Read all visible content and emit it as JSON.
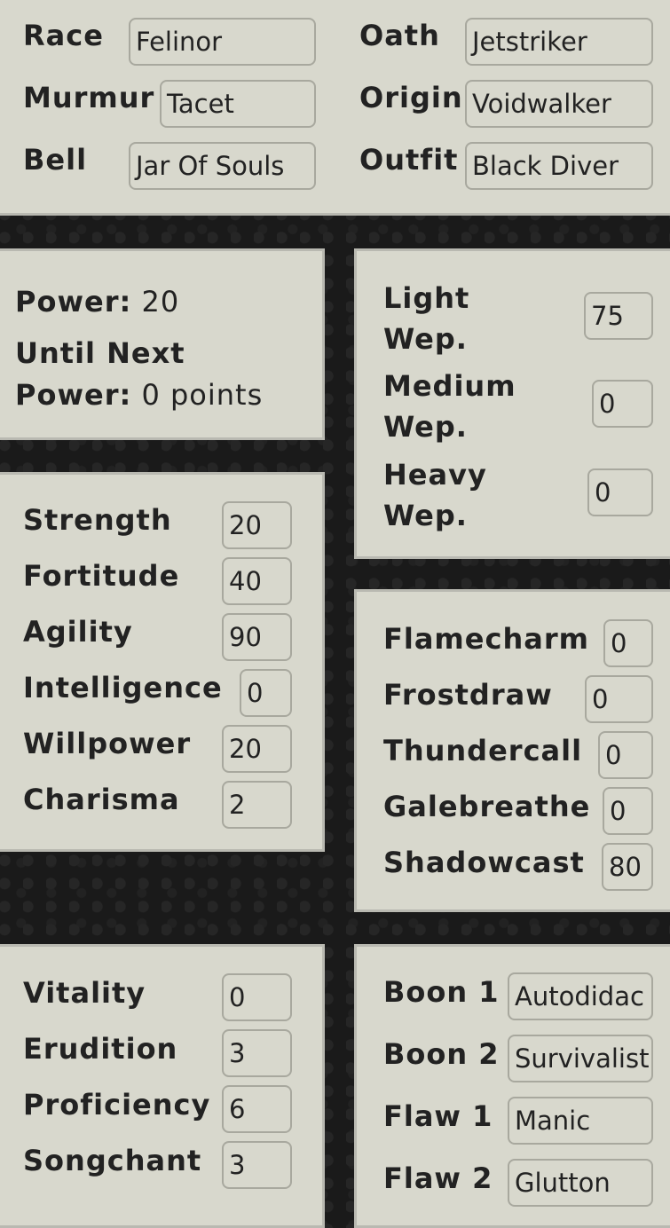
{
  "identity": {
    "race": {
      "label": "Race",
      "value": "Felinor"
    },
    "murmur": {
      "label": "Murmur",
      "value": "Tacet"
    },
    "bell": {
      "label": "Bell",
      "value": "Jar Of Souls"
    },
    "oath": {
      "label": "Oath",
      "value": "Jetstriker"
    },
    "origin": {
      "label": "Origin",
      "value": "Voidwalker"
    },
    "outfit": {
      "label": "Outfit",
      "value": "Black Diver"
    }
  },
  "power": {
    "power_label": "Power:",
    "power_value": "20",
    "until_label_1": "Until Next",
    "until_label_2": "Power:",
    "until_value": "0 points"
  },
  "weapons": [
    {
      "label": "Light Wep.",
      "value": "75"
    },
    {
      "label": "Medium Wep.",
      "value": "0"
    },
    {
      "label": "Heavy Wep.",
      "value": "0"
    }
  ],
  "attributes": [
    {
      "label": "Strength",
      "value": "20"
    },
    {
      "label": "Fortitude",
      "value": "40"
    },
    {
      "label": "Agility",
      "value": "90"
    },
    {
      "label": "Intelligence",
      "value": "0"
    },
    {
      "label": "Willpower",
      "value": "20"
    },
    {
      "label": "Charisma",
      "value": "2"
    }
  ],
  "attunements": [
    {
      "label": "Flamecharm",
      "value": "0"
    },
    {
      "label": "Frostdraw",
      "value": "0"
    },
    {
      "label": "Thundercall",
      "value": "0"
    },
    {
      "label": "Galebreathe",
      "value": "0"
    },
    {
      "label": "Shadowcast",
      "value": "80"
    }
  ],
  "investments": [
    {
      "label": "Vitality",
      "value": "0"
    },
    {
      "label": "Erudition",
      "value": "3"
    },
    {
      "label": "Proficiency",
      "value": "6"
    },
    {
      "label": "Songchant",
      "value": "3"
    }
  ],
  "traits": [
    {
      "label": "Boon 1",
      "value": "Autodidac"
    },
    {
      "label": "Boon 2",
      "value": "Survivalist"
    },
    {
      "label": "Flaw 1",
      "value": "Manic"
    },
    {
      "label": "Flaw 2",
      "value": "Glutton"
    }
  ]
}
